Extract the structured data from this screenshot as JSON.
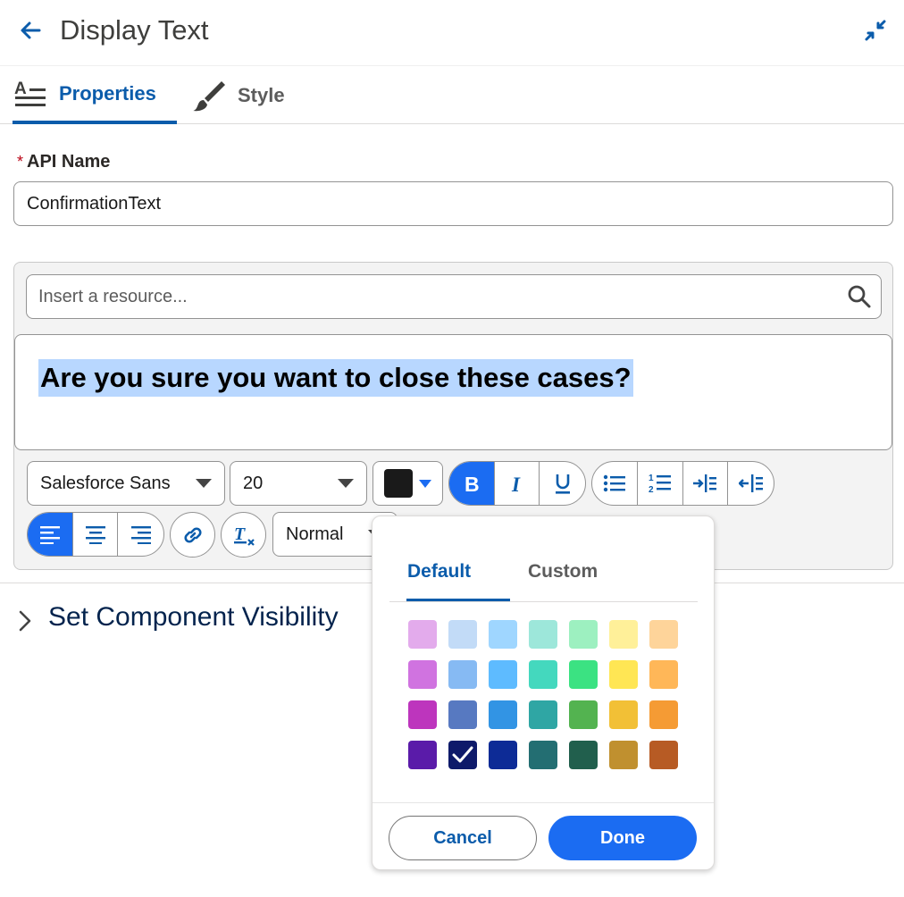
{
  "header": {
    "title": "Display Text"
  },
  "tabs": [
    {
      "label": "Properties",
      "icon": "text-properties-icon"
    },
    {
      "label": "Style",
      "icon": "paintbrush-icon"
    }
  ],
  "api_name": {
    "label": "API Name",
    "required_mark": "*",
    "value": "ConfirmationText"
  },
  "editor": {
    "resource_placeholder": "Insert a resource...",
    "content": "Are you sure you want to close these cases?",
    "font_family": "Salesforce Sans",
    "font_size": "20",
    "text_color": "#1a1a1a",
    "format": "Normal"
  },
  "visibility": {
    "title": "Set Component Visibility"
  },
  "color_picker": {
    "tabs": [
      "Default",
      "Custom"
    ],
    "selected": "#0e1a6a",
    "swatches": [
      [
        "#e3abec",
        "#c2dbf7",
        "#9fd6ff",
        "#9de7da",
        "#9df0c0",
        "#fff099",
        "#fed49a"
      ],
      [
        "#d073e0",
        "#86baf3",
        "#5ebbff",
        "#44d8be",
        "#3be282",
        "#ffe654",
        "#ffb758"
      ],
      [
        "#bd35bd",
        "#5779c1",
        "#3294e4",
        "#2fa6a4",
        "#53b350",
        "#f2c036",
        "#f59b34"
      ],
      [
        "#5a1ba9",
        "#0e1a6a",
        "#0d2b96",
        "#236e72",
        "#215f4d",
        "#c0902f",
        "#b75b24"
      ]
    ],
    "cancel_label": "Cancel",
    "done_label": "Done"
  }
}
